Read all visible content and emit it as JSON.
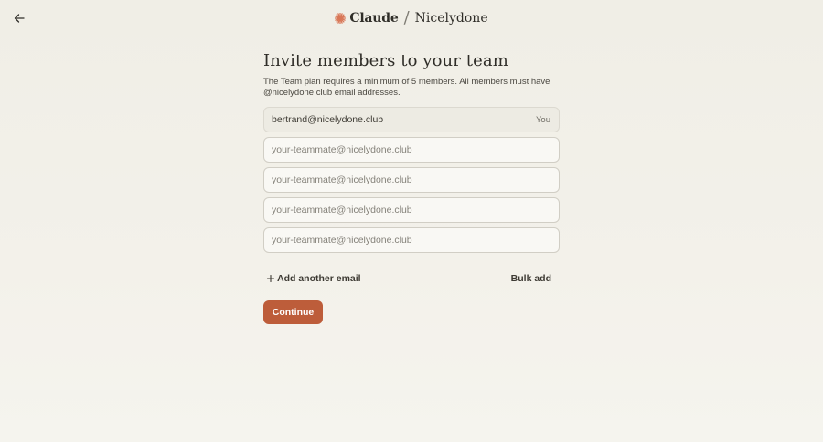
{
  "header": {
    "back_icon": "arrow-left-icon",
    "brand_icon": "claude-starburst-icon",
    "brand_name": "Claude",
    "separator": "/",
    "org_name": "Nicelydone"
  },
  "main": {
    "title": "Invite members to your team",
    "subtitle": "The Team plan requires a minimum of 5 members. All members must have @nicelydone.club email addresses.",
    "owner_email": "bertrand@nicelydone.club",
    "owner_tag": "You",
    "email_placeholder": "your-teammate@nicelydone.club",
    "add_email_label": "Add another email",
    "add_email_icon": "plus-icon",
    "bulk_add_label": "Bulk add",
    "continue_label": "Continue"
  },
  "colors": {
    "accent": "#bd5d3a",
    "brand_icon": "#d97757",
    "background": "#f0eee6"
  }
}
